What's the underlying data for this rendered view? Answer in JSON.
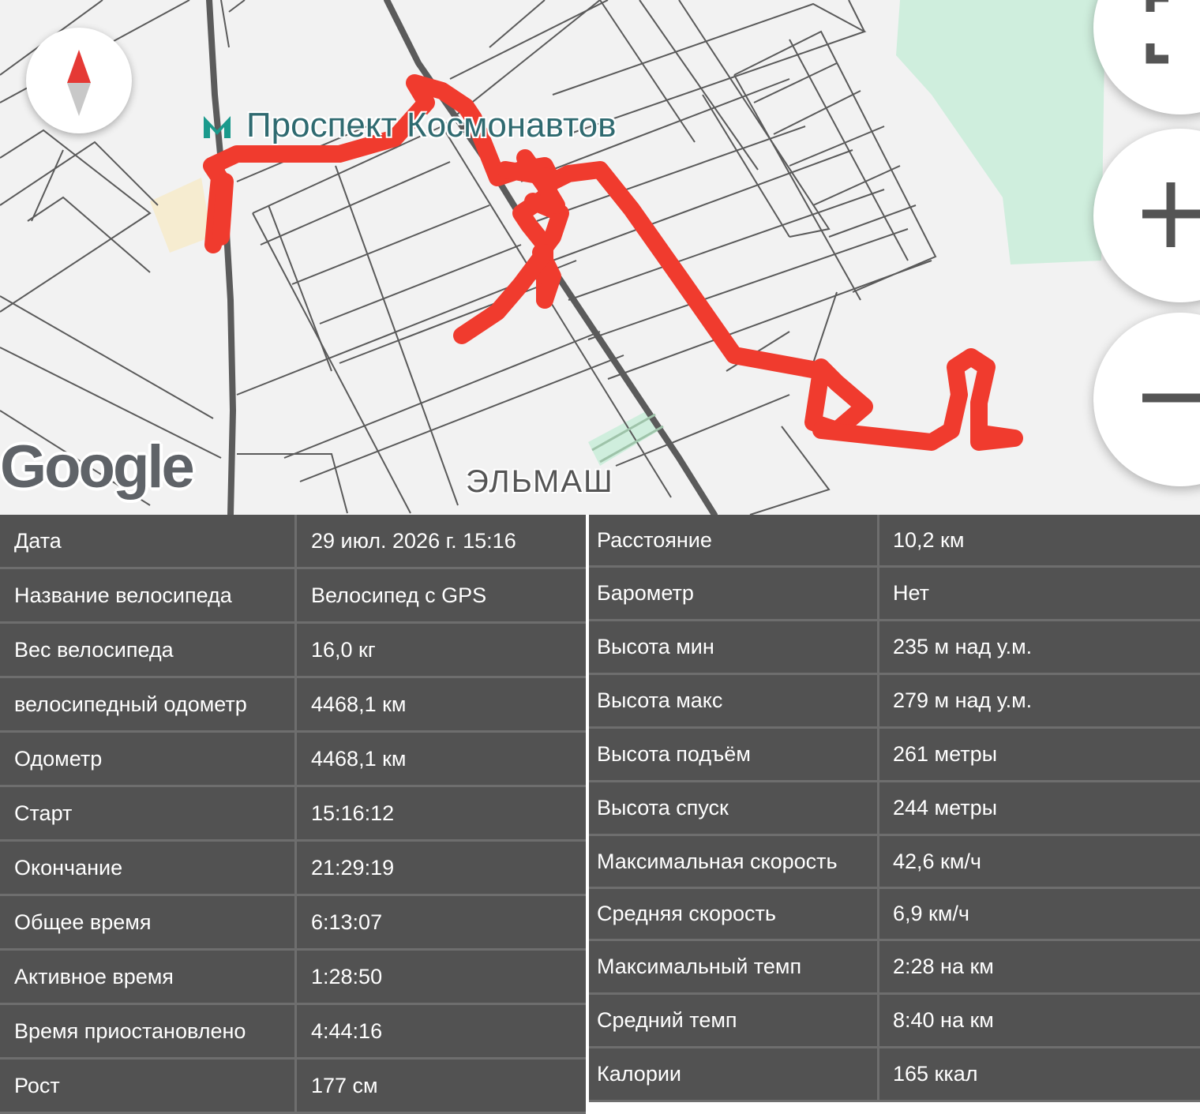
{
  "map": {
    "place_label": "Проспект Космонавтов",
    "district_label": "ЭЛЬМАШ",
    "attribution": "Google",
    "compass_icon": "compass-icon",
    "buttons": [
      "fullscreen-icon",
      "zoom-in-icon",
      "zoom-out-icon"
    ],
    "route_color": "#f03b2e"
  },
  "stats_left": [
    {
      "label": "Дата",
      "value": "29 июл. 2026 г. 15:16"
    },
    {
      "label": "Название велосипеда",
      "value": "Велосипед с GPS"
    },
    {
      "label": "Вес велосипеда",
      "value": "16,0 кг"
    },
    {
      "label": "велосипедный одометр",
      "value": "4468,1 км"
    },
    {
      "label": "Одометр",
      "value": "4468,1 км"
    },
    {
      "label": "Старт",
      "value": "15:16:12"
    },
    {
      "label": "Окончание",
      "value": "21:29:19"
    },
    {
      "label": "Общее время",
      "value": "6:13:07"
    },
    {
      "label": "Активное время",
      "value": "1:28:50"
    },
    {
      "label": "Время приостановлено",
      "value": "4:44:16"
    },
    {
      "label": "Рост",
      "value": "177 см"
    }
  ],
  "stats_right": [
    {
      "label": "Расстояние",
      "value": "10,2 км"
    },
    {
      "label": "Барометр",
      "value": "Нет"
    },
    {
      "label": "Высота мин",
      "value": "235 м над у.м."
    },
    {
      "label": "Высота макс",
      "value": "279 м над у.м."
    },
    {
      "label": "Высота подъём",
      "value": "261 метры"
    },
    {
      "label": "Высота спуск",
      "value": "244 метры"
    },
    {
      "label": "Максимальная скорость",
      "value": "42,6 км/ч"
    },
    {
      "label": "Средняя скорость",
      "value": "6,9 км/ч"
    },
    {
      "label": "Максимальный темп",
      "value": "2:28 на км"
    },
    {
      "label": "Средний темп",
      "value": "8:40 на км"
    },
    {
      "label": "Калории",
      "value": "165 ккал"
    }
  ]
}
